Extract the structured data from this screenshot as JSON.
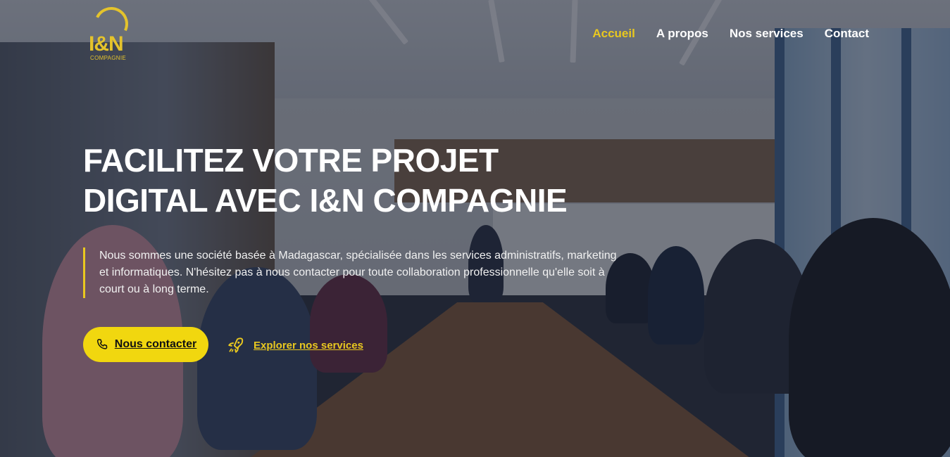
{
  "brand": {
    "logo_main": "I&N",
    "logo_sub": "COMPAGNIE",
    "accent_color": "#e9c81f"
  },
  "nav": {
    "items": [
      {
        "label": "Accueil",
        "active": true
      },
      {
        "label": "A propos",
        "active": false
      },
      {
        "label": "Nos services",
        "active": false
      },
      {
        "label": "Contact",
        "active": false
      }
    ]
  },
  "hero": {
    "headline_line1": "FACILITEZ VOTRE PROJET",
    "headline_line2": "DIGITAL AVEC I&N COMPAGNIE",
    "intro": "Nous sommes une société basée à Madagascar, spécialisée dans les services administratifs, marketing et informatiques. N'hésitez pas à nous contacter pour toute collaboration professionnelle qu'elle soit à court ou à long terme.",
    "contact_button": {
      "label": "Nous contacter",
      "icon": "phone-icon"
    },
    "explore_link": {
      "label": "Explorer nos services",
      "icon": "rocket-icon"
    }
  }
}
